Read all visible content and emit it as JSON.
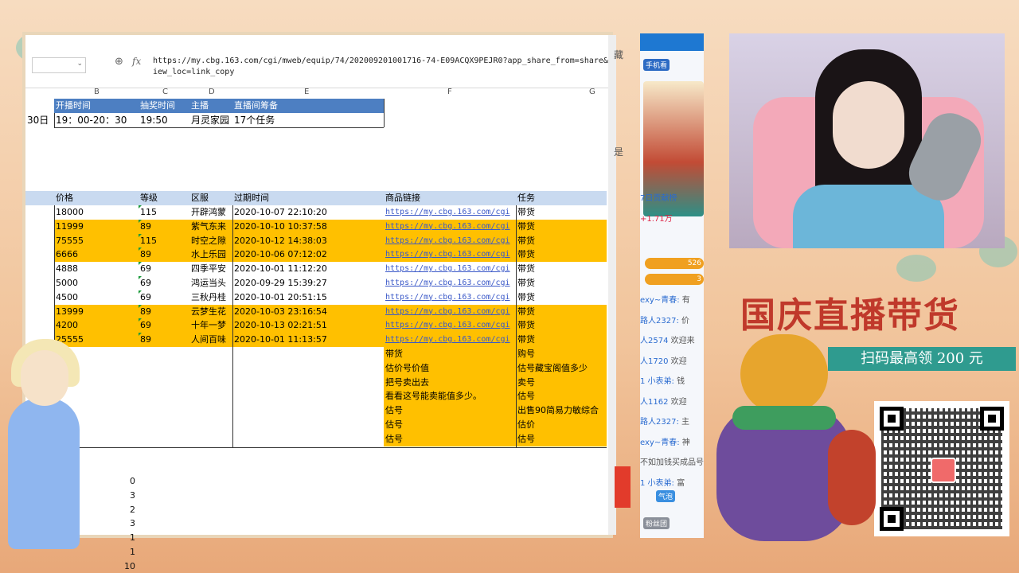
{
  "formula_bar": {
    "fx": "fx",
    "url": "https://my.cbg.163.com/cgi/mweb/equip/74/202009201001716-74-E09ACQX9PEJR0?app_share_from=share&view_loc=link_copy"
  },
  "columns": [
    "B",
    "C",
    "D",
    "E",
    "F",
    "G"
  ],
  "schedule": {
    "headers": [
      "开播时间",
      "抽奖时间",
      "主播",
      "直播间筹备"
    ],
    "row": {
      "prefix": "30日",
      "time": "19：00-20：30",
      "draw": "19:50",
      "host": "月灵家园",
      "prep": "17个任务"
    }
  },
  "table": {
    "headers": [
      "价格",
      "等级",
      "区服",
      "过期时间",
      "商品链接",
      "任务"
    ],
    "rows": [
      {
        "price": "18000",
        "level": "115",
        "server": "开辟鸿蒙",
        "expire": "2020-10-07 22:10:20",
        "link": "https://my.cbg.163.com/cgi",
        "task": "带货",
        "hl": false
      },
      {
        "price": "11999",
        "level": "89",
        "server": "紫气东来",
        "expire": "2020-10-10 10:37:58",
        "link": "https://my.cbg.163.com/cgi",
        "task": "带货",
        "hl": true
      },
      {
        "price": "75555",
        "level": "115",
        "server": "时空之隙",
        "expire": "2020-10-12 14:38:03",
        "link": "https://my.cbg.163.com/cgi",
        "task": "带货",
        "hl": true
      },
      {
        "price": "6666",
        "level": "89",
        "server": "水上乐园",
        "expire": "2020-10-06 07:12:02",
        "link": "https://my.cbg.163.com/cgi",
        "task": "带货",
        "hl": true
      },
      {
        "price": "4888",
        "level": "69",
        "server": "四季平安",
        "expire": "2020-10-01 11:12:20",
        "link": "https://my.cbg.163.com/cgi",
        "task": "带货",
        "hl": false
      },
      {
        "price": "5000",
        "level": "69",
        "server": "鸿运当头",
        "expire": "2020-09-29 15:39:27",
        "link": "https://my.cbg.163.com/cgi",
        "task": "带货",
        "hl": false
      },
      {
        "price": "4500",
        "level": "69",
        "server": "三秋丹桂",
        "expire": "2020-10-01 20:51:15",
        "link": "https://my.cbg.163.com/cgi",
        "task": "带货",
        "hl": false
      },
      {
        "price": "13999",
        "level": "89",
        "server": "云梦生花",
        "expire": "2020-10-03 23:16:54",
        "link": "https://my.cbg.163.com/cgi",
        "task": "带货",
        "hl": true
      },
      {
        "price": "4200",
        "level": "69",
        "server": "十年一梦",
        "expire": "2020-10-13 02:21:51",
        "link": "https://my.cbg.163.com/cgi",
        "task": "带货",
        "hl": true
      },
      {
        "price": "25555",
        "level": "89",
        "server": "人间百味",
        "expire": "2020-10-01 11:13:57",
        "link": "https://my.cbg.163.com/cgi",
        "task": "带货",
        "hl": true
      }
    ],
    "extra_rows": [
      {
        "f": "带货",
        "g": "购号"
      },
      {
        "f": "估价号价值",
        "g": "估号藏宝阁值多少"
      },
      {
        "f": "把号卖出去",
        "g": "卖号"
      },
      {
        "f": "看看这号能卖能值多少。",
        "g": "估号"
      },
      {
        "f": "估号",
        "g": "出售90简易力敏综合"
      },
      {
        "f": "估号",
        "g": "估价"
      },
      {
        "f": "估号",
        "g": "估号"
      }
    ]
  },
  "counts": [
    "0",
    "3",
    "2",
    "3",
    "1",
    "1",
    "10"
  ],
  "side_panel": {
    "btn_phone": "手机看",
    "rank_label": "7日贡献榜",
    "fans": "+1.71万",
    "stat1": "526",
    "stat2": "3",
    "chats": [
      {
        "user": "exy~青春:",
        "msg": "有"
      },
      {
        "user": "路人2327:",
        "msg": "价"
      },
      {
        "user": "人2574",
        "msg": "欢迎来"
      },
      {
        "user": "人1720",
        "msg": "欢迎"
      },
      {
        "user": "1 小表弟:",
        "msg": "钱"
      },
      {
        "user": "人1162",
        "msg": "欢迎"
      },
      {
        "user": "路人2327:",
        "msg": "主"
      },
      {
        "user": "exy~青春:",
        "msg": "神"
      },
      {
        "user": "",
        "msg": "不如加钱买成品号"
      },
      {
        "user": "1 小表弟:",
        "msg": "富"
      }
    ],
    "tag_qiqi": "气泡",
    "fan_group": "粉丝团",
    "cut_text1": "藏",
    "cut_text2": "是"
  },
  "promo": {
    "title": "国庆直播带货",
    "subtitle": "扫码最高领 200 元"
  },
  "colors": {
    "header_blue": "#4d7fc2",
    "header_light": "#c9daf0",
    "highlight": "#ffc000",
    "link": "#3a58c8",
    "promo_red": "#c0392b",
    "promo_teal": "#2f9b8f"
  }
}
